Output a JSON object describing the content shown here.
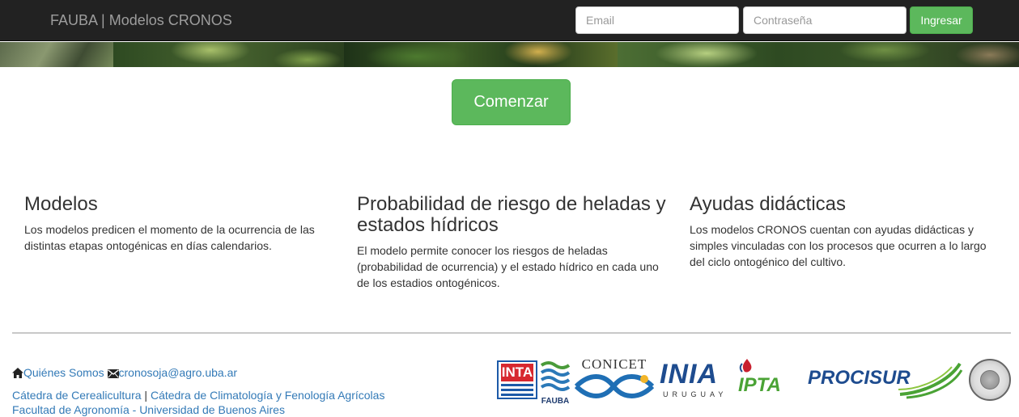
{
  "navbar": {
    "brand": "FAUBA | Modelos CRONOS",
    "email_placeholder": "Email",
    "password_placeholder": "Contraseña",
    "login_label": "Ingresar"
  },
  "hero": {
    "start_label": "Comenzar"
  },
  "features": [
    {
      "title": "Modelos",
      "text": "Los modelos predicen el momento de la ocurrencia de las distintas etapas ontogénicas en días calendarios."
    },
    {
      "title": "Probabilidad de riesgo de heladas y estados hídricos",
      "text": "El modelo permite conocer los riesgos de heladas (probabilidad de ocurrencia) y el estado hídrico en cada uno de los estadios ontogénicos."
    },
    {
      "title": "Ayudas didácticas",
      "text": "Los modelos CRONOS cuentan con ayudas didácticas y simples vinculadas con los procesos que ocurren a lo largo del ciclo ontogénico del cultivo."
    }
  ],
  "footer": {
    "about_label": "Quiénes Somos",
    "email_label": "cronosoja@agro.uba.ar",
    "catedra1": "Cátedra de Cerealicultura",
    "separator": "|",
    "catedra2": "Cátedra de Climatología y Fenología Agrícolas",
    "faculty_partial": "Facultad de Agronomía - Universidad de Buenos Aires",
    "logos": {
      "inta": "INTA",
      "fauba": "FAUBA",
      "conicet": "CONICET",
      "inia": "INIA",
      "inia_sub": "URUGUAY",
      "ipta": "IPTA",
      "procisur": "PROCISUR"
    }
  },
  "colors": {
    "navbar_bg": "#222222",
    "success": "#5cb85c",
    "link": "#337ab7"
  }
}
